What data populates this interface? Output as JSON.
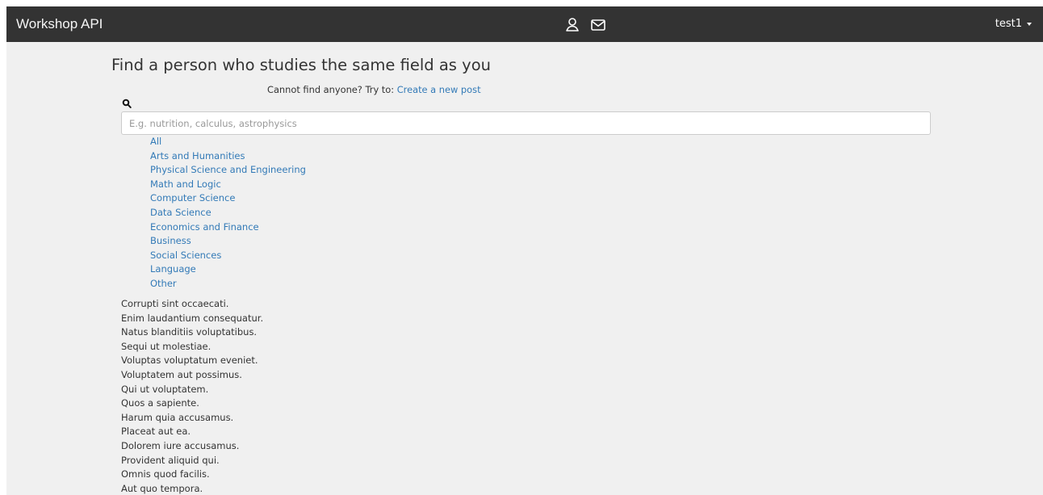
{
  "header": {
    "brand": "Workshop API",
    "icons": [
      "user-icon",
      "mail-icon"
    ],
    "user_menu": "test1"
  },
  "main": {
    "title": "Find a person who studies the same field as you",
    "hint_prefix": "Cannot find anyone? Try to:",
    "hint_link": "Create a new post",
    "search": {
      "icon": "search-icon",
      "placeholder": "E.g. nutrition, calculus, astrophysics",
      "value": ""
    },
    "categories": [
      "All",
      "Arts and Humanities",
      "Physical Science and Engineering",
      "Math and Logic",
      "Computer Science",
      "Data Science",
      "Economics and Finance",
      "Business",
      "Social Sciences",
      "Language",
      "Other"
    ],
    "posts": [
      "Corrupti sint occaecati.",
      "Enim laudantium consequatur.",
      "Natus blanditiis voluptatibus.",
      "Sequi ut molestiae.",
      "Voluptas voluptatum eveniet.",
      "Voluptatem aut possimus.",
      "Qui ut voluptatem.",
      "Quos a sapiente.",
      "Harum quia accusamus.",
      "Placeat aut ea.",
      "Dolorem iure accusamus.",
      "Provident aliquid qui.",
      "Omnis quod facilis.",
      "Aut quo tempora."
    ]
  },
  "colors": {
    "navbar": "#333333",
    "page_background": "#f0f0f0",
    "link": "#337ab7",
    "text": "#333333"
  }
}
